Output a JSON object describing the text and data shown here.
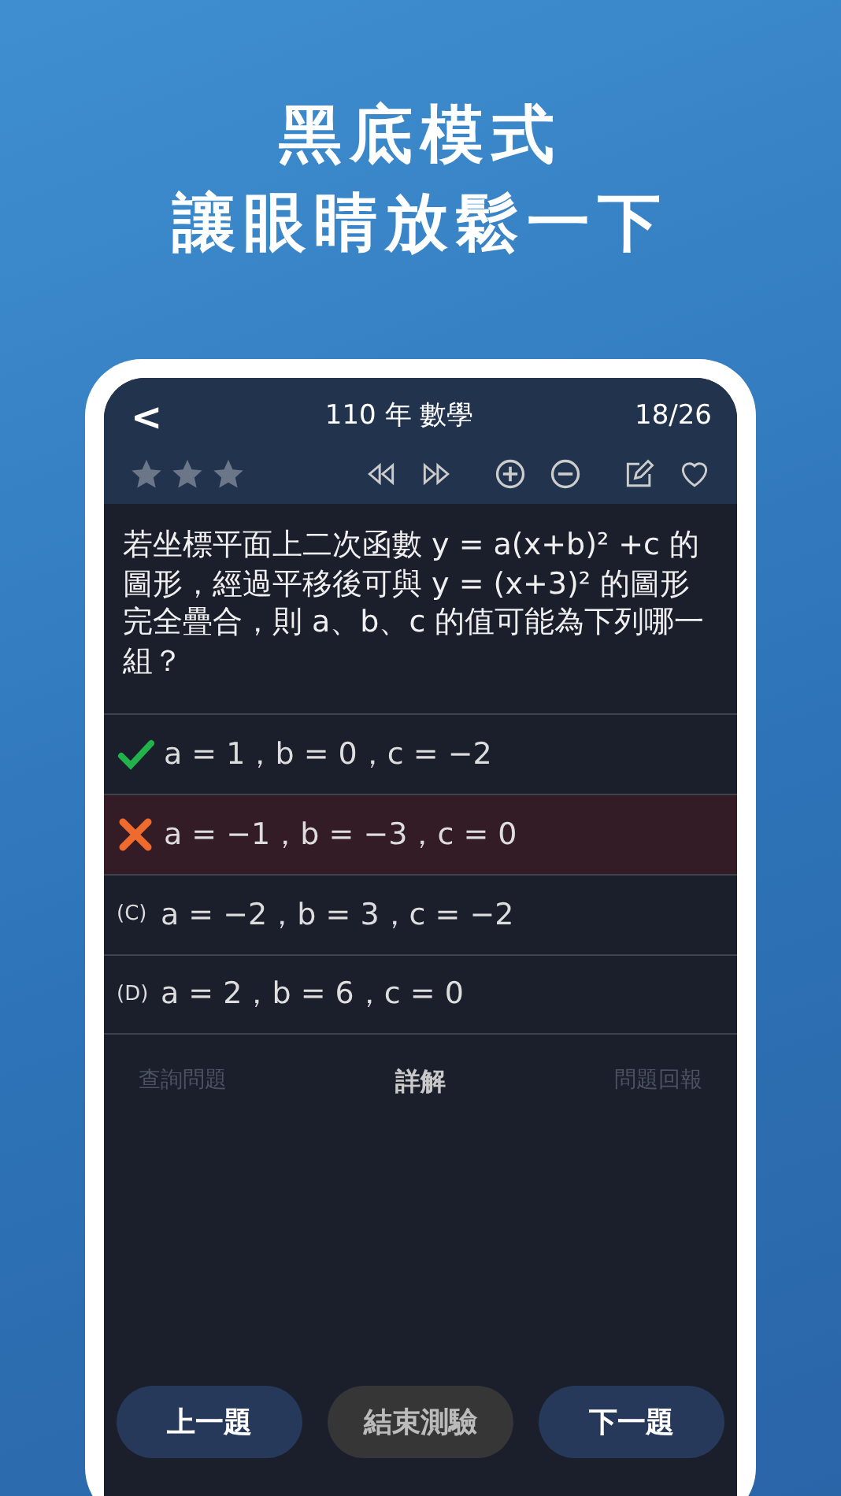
{
  "headline": [
    "黑底模式",
    "讓眼睛放鬆一下"
  ],
  "nav": {
    "back": "<",
    "title": "110 年  數學",
    "counter": "18/26"
  },
  "question": "若坐標平面上二次函數 y = a(x+b)² +c 的圖形，經過平移後可與 y = (x+3)² 的圖形完全疊合，則 a、b、c 的值可能為下列哪一組？",
  "options": [
    {
      "kind": "correct",
      "text": "a = 1，b = 0，c = −2",
      "selected": false
    },
    {
      "kind": "wrong",
      "text": "a = −1，b = −3，c = 0",
      "selected": true
    },
    {
      "kind": "plain",
      "label": "(C)",
      "text": "a = −2，b = 3，c = −2",
      "selected": false
    },
    {
      "kind": "plain",
      "label": "(D)",
      "text": "a = 2，b = 6，c = 0",
      "selected": false
    }
  ],
  "tabs": [
    {
      "label": "查詢問題",
      "selected": false
    },
    {
      "label": "詳解",
      "selected": true
    },
    {
      "label": "問題回報",
      "selected": false
    }
  ],
  "buttons": [
    {
      "label": "上一題",
      "kind": "nav"
    },
    {
      "label": "結束測驗",
      "kind": "end"
    },
    {
      "label": "下一題",
      "kind": "nav"
    }
  ]
}
